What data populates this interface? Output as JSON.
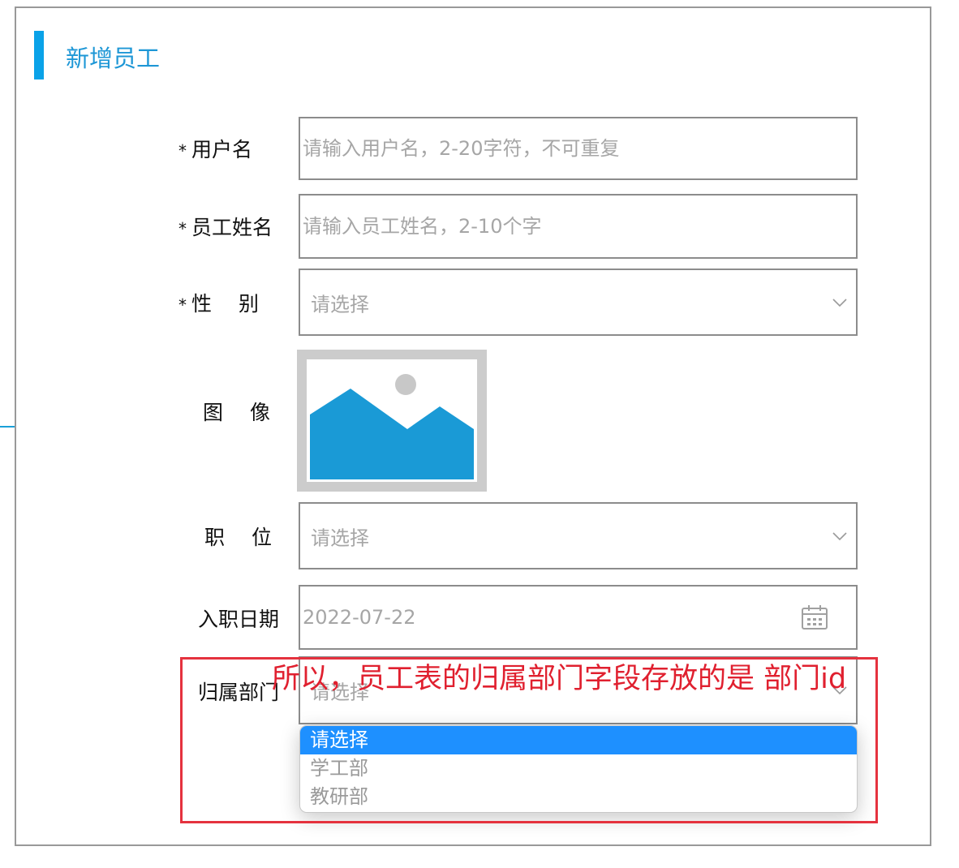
{
  "header": {
    "title": "新增员工"
  },
  "form": {
    "username": {
      "required_mark": "*",
      "label": "用户名",
      "placeholder": "请输入用户名，2-20字符，不可重复"
    },
    "name": {
      "required_mark": "*",
      "label": "员工姓名",
      "placeholder": "请输入员工姓名，2-10个字"
    },
    "gender": {
      "required_mark": "*",
      "label": "性　 别",
      "selected": "请选择"
    },
    "image": {
      "label": "图　 像",
      "icon": "image-placeholder-icon"
    },
    "position": {
      "label": "职　 位",
      "selected": "请选择"
    },
    "entry_date": {
      "label": "入职日期",
      "value": "2022-07-22",
      "icon": "calendar-icon"
    },
    "department": {
      "label": "归属部门",
      "selected": "请选择",
      "options": [
        "请选择",
        "学工部",
        "教研部"
      ]
    }
  },
  "annotation": {
    "text": "所以，员工表的归属部门字段存放的是 部门id",
    "color": "#e5323e"
  },
  "colors": {
    "accent": "#0aa2e8",
    "title": "#1e97d6",
    "option_highlight": "#1e90ff"
  }
}
